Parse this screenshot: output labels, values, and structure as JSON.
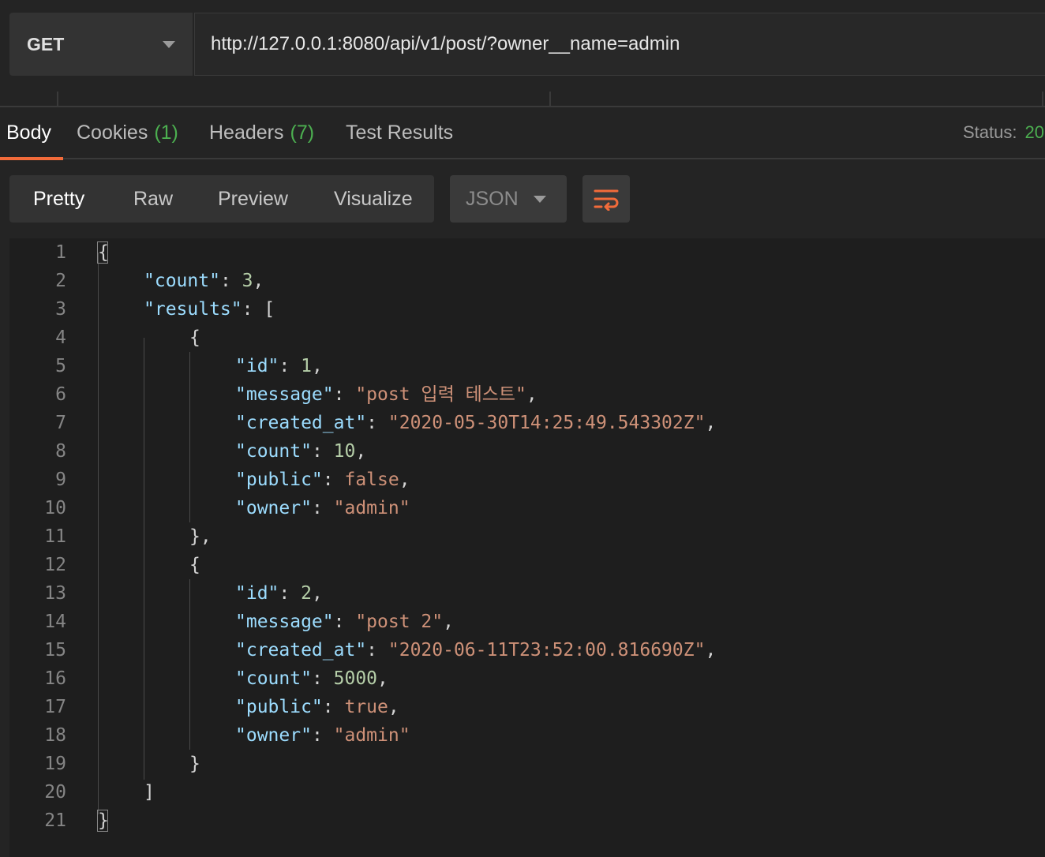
{
  "request": {
    "method": "GET",
    "url": "http://127.0.0.1:8080/api/v1/post/?owner__name=admin"
  },
  "response_tabs": [
    {
      "label": "Body",
      "count": ""
    },
    {
      "label": "Cookies",
      "count": "(1)"
    },
    {
      "label": "Headers",
      "count": "(7)"
    },
    {
      "label": "Test Results",
      "count": ""
    }
  ],
  "status": {
    "label": "Status:",
    "value": "20"
  },
  "view_modes": [
    "Pretty",
    "Raw",
    "Preview",
    "Visualize"
  ],
  "format": "JSON",
  "wrap_icon": "wrap-lines-icon",
  "colors": {
    "accent": "#f26b3a",
    "key": "#9cdcfe",
    "number": "#b5cea8",
    "string": "#ce9178",
    "count_green": "#4caf50"
  },
  "code_lines": [
    {
      "num": "1",
      "indent": 0,
      "tokens": [
        {
          "t": "{",
          "c": "p"
        }
      ]
    },
    {
      "num": "2",
      "indent": 1,
      "tokens": [
        {
          "t": "\"count\"",
          "c": "k"
        },
        {
          "t": ": ",
          "c": "p"
        },
        {
          "t": "3",
          "c": "n"
        },
        {
          "t": ",",
          "c": "p"
        }
      ]
    },
    {
      "num": "3",
      "indent": 1,
      "tokens": [
        {
          "t": "\"results\"",
          "c": "k"
        },
        {
          "t": ": [",
          "c": "p"
        }
      ]
    },
    {
      "num": "4",
      "indent": 2,
      "tokens": [
        {
          "t": "{",
          "c": "p"
        }
      ]
    },
    {
      "num": "5",
      "indent": 3,
      "tokens": [
        {
          "t": "\"id\"",
          "c": "k"
        },
        {
          "t": ": ",
          "c": "p"
        },
        {
          "t": "1",
          "c": "n"
        },
        {
          "t": ",",
          "c": "p"
        }
      ]
    },
    {
      "num": "6",
      "indent": 3,
      "tokens": [
        {
          "t": "\"message\"",
          "c": "k"
        },
        {
          "t": ": ",
          "c": "p"
        },
        {
          "t": "\"post 입력 테스트\"",
          "c": "s"
        },
        {
          "t": ",",
          "c": "p"
        }
      ]
    },
    {
      "num": "7",
      "indent": 3,
      "tokens": [
        {
          "t": "\"created_at\"",
          "c": "k"
        },
        {
          "t": ": ",
          "c": "p"
        },
        {
          "t": "\"2020-05-30T14:25:49.543302Z\"",
          "c": "s"
        },
        {
          "t": ",",
          "c": "p"
        }
      ]
    },
    {
      "num": "8",
      "indent": 3,
      "tokens": [
        {
          "t": "\"count\"",
          "c": "k"
        },
        {
          "t": ": ",
          "c": "p"
        },
        {
          "t": "10",
          "c": "n"
        },
        {
          "t": ",",
          "c": "p"
        }
      ]
    },
    {
      "num": "9",
      "indent": 3,
      "tokens": [
        {
          "t": "\"public\"",
          "c": "k"
        },
        {
          "t": ": ",
          "c": "p"
        },
        {
          "t": "false",
          "c": "b"
        },
        {
          "t": ",",
          "c": "p"
        }
      ]
    },
    {
      "num": "10",
      "indent": 3,
      "tokens": [
        {
          "t": "\"owner\"",
          "c": "k"
        },
        {
          "t": ": ",
          "c": "p"
        },
        {
          "t": "\"admin\"",
          "c": "s"
        }
      ]
    },
    {
      "num": "11",
      "indent": 2,
      "tokens": [
        {
          "t": "},",
          "c": "p"
        }
      ]
    },
    {
      "num": "12",
      "indent": 2,
      "tokens": [
        {
          "t": "{",
          "c": "p"
        }
      ]
    },
    {
      "num": "13",
      "indent": 3,
      "tokens": [
        {
          "t": "\"id\"",
          "c": "k"
        },
        {
          "t": ": ",
          "c": "p"
        },
        {
          "t": "2",
          "c": "n"
        },
        {
          "t": ",",
          "c": "p"
        }
      ]
    },
    {
      "num": "14",
      "indent": 3,
      "tokens": [
        {
          "t": "\"message\"",
          "c": "k"
        },
        {
          "t": ": ",
          "c": "p"
        },
        {
          "t": "\"post 2\"",
          "c": "s"
        },
        {
          "t": ",",
          "c": "p"
        }
      ]
    },
    {
      "num": "15",
      "indent": 3,
      "tokens": [
        {
          "t": "\"created_at\"",
          "c": "k"
        },
        {
          "t": ": ",
          "c": "p"
        },
        {
          "t": "\"2020-06-11T23:52:00.816690Z\"",
          "c": "s"
        },
        {
          "t": ",",
          "c": "p"
        }
      ]
    },
    {
      "num": "16",
      "indent": 3,
      "tokens": [
        {
          "t": "\"count\"",
          "c": "k"
        },
        {
          "t": ": ",
          "c": "p"
        },
        {
          "t": "5000",
          "c": "n"
        },
        {
          "t": ",",
          "c": "p"
        }
      ]
    },
    {
      "num": "17",
      "indent": 3,
      "tokens": [
        {
          "t": "\"public\"",
          "c": "k"
        },
        {
          "t": ": ",
          "c": "p"
        },
        {
          "t": "true",
          "c": "b"
        },
        {
          "t": ",",
          "c": "p"
        }
      ]
    },
    {
      "num": "18",
      "indent": 3,
      "tokens": [
        {
          "t": "\"owner\"",
          "c": "k"
        },
        {
          "t": ": ",
          "c": "p"
        },
        {
          "t": "\"admin\"",
          "c": "s"
        }
      ]
    },
    {
      "num": "19",
      "indent": 2,
      "tokens": [
        {
          "t": "}",
          "c": "p"
        }
      ]
    },
    {
      "num": "20",
      "indent": 1,
      "tokens": [
        {
          "t": "]",
          "c": "p"
        }
      ]
    },
    {
      "num": "21",
      "indent": 0,
      "tokens": [
        {
          "t": "}",
          "c": "p"
        }
      ]
    }
  ]
}
